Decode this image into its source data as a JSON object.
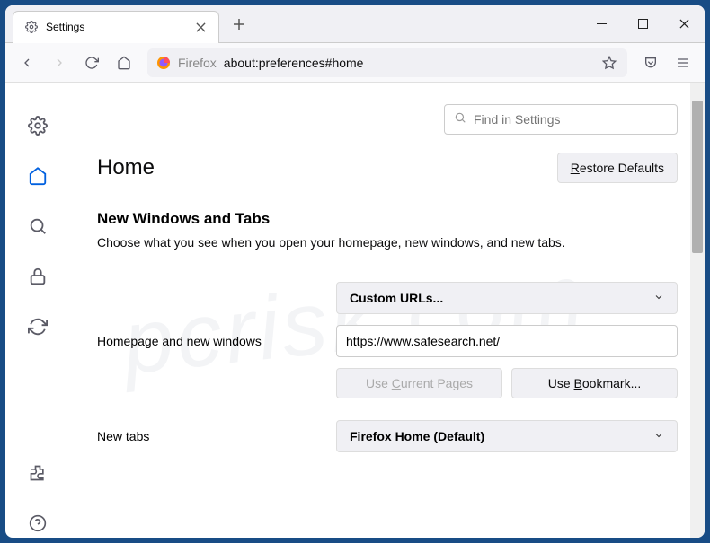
{
  "tab": {
    "title": "Settings"
  },
  "urlbar": {
    "prefix": "Firefox",
    "path": "about:preferences#home"
  },
  "search": {
    "placeholder": "Find in Settings"
  },
  "page": {
    "title": "Home",
    "restore_btn": "Restore Defaults",
    "section_title": "New Windows and Tabs",
    "section_desc": "Choose what you see when you open your homepage, new windows, and new tabs."
  },
  "form": {
    "custom_select": "Custom URLs...",
    "homepage_label": "Homepage and new windows",
    "homepage_value": "https://www.safesearch.net/",
    "use_current": "Use Current Pages",
    "use_bookmark": "Use Bookmark...",
    "newtabs_label": "New tabs",
    "newtabs_select": "Firefox Home (Default)"
  },
  "watermark": "pcrisk.com"
}
